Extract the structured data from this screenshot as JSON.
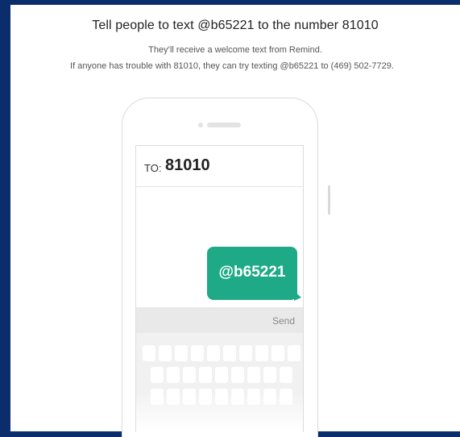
{
  "header": {
    "title": "Tell people to text @b65221 to the number 81010",
    "subtitle": "They’ll receive a welcome text from Remind.",
    "fallback": "If anyone has trouble with 81010, they can try texting @b65221 to (469) 502-7729."
  },
  "phone": {
    "to_label": "TO:",
    "to_number": "81010",
    "message": "@b65221",
    "send_label": "Send"
  },
  "colors": {
    "background": "#0c2d6b",
    "bubble": "#1eaa86"
  }
}
